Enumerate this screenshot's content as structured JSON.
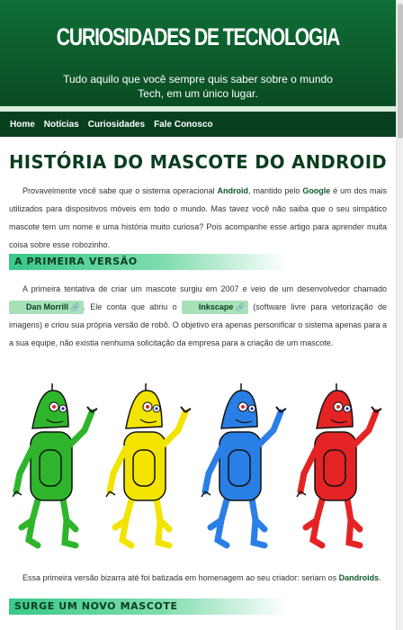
{
  "site": {
    "title": "CURIOSIDADES DE TECNOLOGIA",
    "tagline": "Tudo aquilo que você sempre quis saber sobre o mundo Tech, em um único lugar."
  },
  "nav": {
    "items": [
      "Home",
      "Notícias",
      "Curiosidades",
      "Fale Conosco"
    ]
  },
  "article": {
    "title": "História do mascote do Android",
    "intro": {
      "t1": "Provavelmente você sabe que o sistema operacional ",
      "b1": "Android",
      "t2": ", mantido pelo ",
      "b2": "Google",
      "t3": " é um dos mais utilizados para dispositivos móveis em todo o mundo. Mas tavez você não saiba que o seu simpático mascote tem um nome e uma história muito curiosa? Pois acompanhe esse artigo para aprender muita coisa sobre esse robozinho."
    },
    "section1": {
      "heading": "A primeira versão",
      "t1": "A primeira tentativa de criar um mascote surgiu em 2007 e veio de um desenvolvedor chamado ",
      "chip1": "Dan Morrill",
      "t2": ". Ele conta que abriu o ",
      "chip2": "Inkscape",
      "t3": " (software livre para vetorização de imagens) e criou sua própria versão de robô. O objetivo era apenas personificar o sistema apenas para a a sua equipe, não existia nenhuma solicitação da empresa para a criação de um mascote.",
      "caption_t1": "Essa primeira versão bizarra até foi batizada em homenagem ao seu criador: seriam os ",
      "caption_b": "Dandroids",
      "caption_t2": "."
    },
    "section2": {
      "heading": "Surge um novo mascote"
    }
  },
  "chip_icon": "external-link-icon",
  "colors": {
    "header_top": "#0f6f36",
    "header_bottom": "#0a4a22",
    "nav_bg": "#083f1e",
    "title_text": "#0b3d1f",
    "chip_bg": "#a8e0b8",
    "robot_green": "#2fb52c",
    "robot_yellow": "#f2e400",
    "robot_blue": "#2a7fe6",
    "robot_red": "#e42424"
  },
  "robots": [
    "green",
    "yellow",
    "blue",
    "red"
  ]
}
